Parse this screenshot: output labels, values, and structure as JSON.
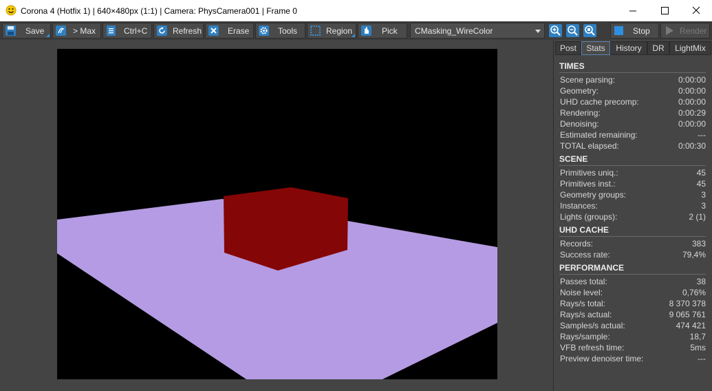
{
  "window": {
    "title": "Corona 4 (Hotfix 1) | 640×480px (1:1) | Camera: PhysCamera001 | Frame 0"
  },
  "toolbar": {
    "save": "Save",
    "max": "> Max",
    "ctrlc": "Ctrl+C",
    "refresh": "Refresh",
    "erase": "Erase",
    "tools": "Tools",
    "region": "Region",
    "pick": "Pick",
    "channel_selected": "CMasking_WireColor",
    "stop": "Stop",
    "render": "Render"
  },
  "tabs": [
    "Post",
    "Stats",
    "History",
    "DR",
    "LightMix"
  ],
  "stats": {
    "times": {
      "title": "TIMES",
      "rows": [
        {
          "k": "Scene parsing:",
          "v": "0:00:00"
        },
        {
          "k": "Geometry:",
          "v": "0:00:00"
        },
        {
          "k": "UHD cache precomp:",
          "v": "0:00:00"
        },
        {
          "k": "Rendering:",
          "v": "0:00:29"
        },
        {
          "k": "Denoising:",
          "v": "0:00:00"
        },
        {
          "k": "Estimated remaining:",
          "v": "---"
        },
        {
          "k": "TOTAL elapsed:",
          "v": "0:00:30"
        }
      ]
    },
    "scene": {
      "title": "SCENE",
      "rows": [
        {
          "k": "Primitives uniq.:",
          "v": "45"
        },
        {
          "k": "Primitives inst.:",
          "v": "45"
        },
        {
          "k": "Geometry groups:",
          "v": "3"
        },
        {
          "k": "Instances:",
          "v": "3"
        },
        {
          "k": "Lights (groups):",
          "v": "2 (1)"
        }
      ]
    },
    "uhd": {
      "title": "UHD CACHE",
      "rows": [
        {
          "k": "Records:",
          "v": "383"
        },
        {
          "k": "Success rate:",
          "v": "79,4%"
        }
      ]
    },
    "perf": {
      "title": "PERFORMANCE",
      "rows": [
        {
          "k": "Passes total:",
          "v": "38"
        },
        {
          "k": "Noise level:",
          "v": "0,76%"
        },
        {
          "k": "Rays/s total:",
          "v": "8 370 378"
        },
        {
          "k": "Rays/s actual:",
          "v": "9 065 761"
        },
        {
          "k": "Samples/s actual:",
          "v": "474 421"
        },
        {
          "k": "Rays/sample:",
          "v": "18,7"
        },
        {
          "k": "VFB refresh time:",
          "v": "5ms"
        },
        {
          "k": "Preview denoiser time:",
          "v": "---"
        }
      ]
    }
  },
  "colors": {
    "floor": "#b59be3",
    "box": "#850606",
    "accent": "#3a8fd0"
  }
}
